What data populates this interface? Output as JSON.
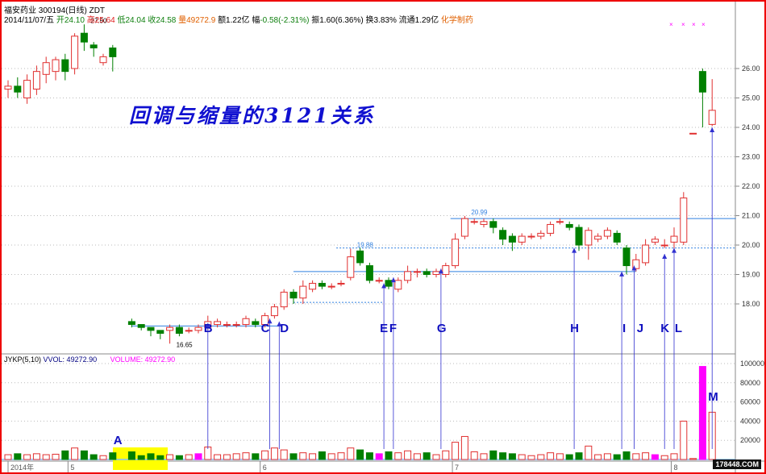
{
  "header": {
    "name": "福安药业 300194(日线) ZDT",
    "date": "2014/11/07/五",
    "open_l": "开",
    "open": "24.10",
    "high_l": "高",
    "high": "25.64",
    "low_l": "低",
    "low": "24.04",
    "close_l": "收",
    "close": "24.58",
    "vol_l": "量",
    "vol": "49272.9",
    "amt": "额1.22亿",
    "chg_l": "幅",
    "chg": "-0.58(-2.31%)",
    "amp": "振1.60(6.36%)",
    "turn": "换3.83%",
    "float": "流通1.29亿",
    "sector": "化学制药"
  },
  "annotation_title": "回调与缩量的3121关系",
  "volume_legend": {
    "ind": "JYKP(5,10)",
    "vvol": "VVOL: 49272.90",
    "volume": "VOLUME: 49272.90"
  },
  "watermark": "178448.COM",
  "colors": {
    "up": "#e03030",
    "down": "#008000",
    "line": "#3080e0",
    "arrow": "#3030d0",
    "highlight": "#ffff00",
    "magenta": "#ff00ff"
  },
  "chart_data": {
    "type": "candlestick",
    "price_ticks": [
      "26.00",
      "25.00",
      "24.00",
      "23.00",
      "22.00",
      "21.00",
      "20.00",
      "19.00",
      "18.00"
    ],
    "price_tick_values": [
      26,
      25,
      24,
      23,
      22,
      21,
      20,
      19,
      18
    ],
    "volume_ticks": [
      "100000",
      "80000",
      "60000",
      "40000",
      "20000"
    ],
    "volume_tick_values": [
      100000,
      80000,
      60000,
      40000,
      20000
    ],
    "x_labels": [
      {
        "i": 0,
        "t": "2014年"
      },
      {
        "i": 6.3,
        "t": "5"
      },
      {
        "i": 26.5,
        "t": "6"
      },
      {
        "i": 46.7,
        "t": "7"
      },
      {
        "i": 69.7,
        "t": "8"
      }
    ],
    "price_labels": [
      {
        "i": 8,
        "p": 27.5,
        "t": "27.50"
      },
      {
        "i": 17,
        "p": 16.65,
        "t": "16.65"
      },
      {
        "i": 36,
        "p": 19.88,
        "t": "19.88"
      },
      {
        "i": 48,
        "p": 20.99,
        "t": "20.99"
      }
    ],
    "candles": [
      [
        25.3,
        25.4,
        25.6,
        25.0,
        5000
      ],
      [
        25.4,
        25.2,
        25.7,
        25.0,
        6000
      ],
      [
        25.0,
        25.6,
        25.8,
        24.8,
        5000
      ],
      [
        25.3,
        25.9,
        26.1,
        25.1,
        6000
      ],
      [
        25.8,
        26.2,
        26.4,
        25.5,
        5000
      ],
      [
        25.9,
        26.3,
        26.4,
        25.6,
        5500
      ],
      [
        26.3,
        25.9,
        26.5,
        25.6,
        9000
      ],
      [
        26.0,
        27.1,
        27.2,
        25.8,
        12000
      ],
      [
        27.2,
        26.9,
        27.5,
        26.6,
        9000
      ],
      [
        26.8,
        26.7,
        26.9,
        26.4,
        5000
      ],
      [
        26.2,
        26.4,
        26.5,
        26.1,
        4000
      ],
      [
        26.7,
        26.4,
        26.8,
        25.9,
        7000
      ],
      null,
      [
        17.4,
        17.3,
        17.5,
        17.2,
        8000
      ],
      [
        17.3,
        17.2,
        17.3,
        17.1,
        4000
      ],
      [
        17.2,
        17.1,
        17.2,
        16.9,
        6000
      ],
      [
        17.1,
        17.0,
        17.1,
        16.8,
        4000
      ],
      [
        17.1,
        17.2,
        17.3,
        16.65,
        5000
      ],
      [
        17.2,
        17.0,
        17.3,
        16.9,
        4000
      ],
      [
        17.1,
        17.1,
        17.2,
        17.0,
        5000
      ],
      [
        17.1,
        17.2,
        17.3,
        17.0,
        6000
      ],
      [
        17.2,
        17.4,
        17.6,
        17.1,
        13000
      ],
      [
        17.3,
        17.4,
        17.5,
        17.2,
        5000
      ],
      [
        17.3,
        17.3,
        17.4,
        17.2,
        5000
      ],
      [
        17.3,
        17.3,
        17.4,
        17.2,
        6000
      ],
      [
        17.3,
        17.5,
        17.6,
        17.2,
        7000
      ],
      [
        17.4,
        17.3,
        17.5,
        17.2,
        6000
      ],
      [
        17.3,
        17.6,
        17.7,
        17.2,
        9000
      ],
      [
        17.6,
        17.9,
        18.0,
        17.5,
        12000
      ],
      [
        17.9,
        18.4,
        18.5,
        17.8,
        10000
      ],
      [
        18.4,
        18.2,
        18.5,
        18.0,
        6000
      ],
      [
        18.2,
        18.6,
        18.8,
        18.0,
        7000
      ],
      [
        18.5,
        18.7,
        18.8,
        18.4,
        6000
      ],
      [
        18.7,
        18.6,
        18.8,
        18.5,
        8000
      ],
      [
        18.6,
        18.6,
        18.7,
        18.5,
        6000
      ],
      [
        18.7,
        18.7,
        18.8,
        18.6,
        7000
      ],
      [
        18.9,
        19.6,
        19.88,
        18.8,
        12000
      ],
      [
        19.8,
        19.4,
        19.9,
        19.3,
        10000
      ],
      [
        19.3,
        18.8,
        19.4,
        18.7,
        7000
      ],
      [
        18.8,
        18.8,
        18.9,
        18.7,
        6000
      ],
      [
        18.8,
        18.6,
        18.9,
        18.5,
        8000
      ],
      [
        18.5,
        18.8,
        18.9,
        18.4,
        7000
      ],
      [
        18.8,
        19.1,
        19.3,
        18.7,
        9000
      ],
      [
        19.1,
        19.1,
        19.2,
        18.9,
        6000
      ],
      [
        19.1,
        19.0,
        19.2,
        18.9,
        7000
      ],
      [
        19.0,
        19.1,
        19.2,
        18.9,
        5000
      ],
      [
        19.0,
        19.3,
        19.4,
        18.9,
        9000
      ],
      [
        19.3,
        20.2,
        20.4,
        19.2,
        18000
      ],
      [
        20.3,
        20.9,
        20.99,
        20.2,
        24000
      ],
      [
        20.8,
        20.8,
        20.9,
        20.7,
        8000
      ],
      [
        20.7,
        20.8,
        20.9,
        20.6,
        6000
      ],
      [
        20.8,
        20.6,
        20.9,
        20.4,
        9000
      ],
      [
        20.5,
        20.2,
        20.6,
        20.0,
        7000
      ],
      [
        20.3,
        20.1,
        20.4,
        19.8,
        6000
      ],
      [
        20.1,
        20.3,
        20.4,
        20.0,
        5000
      ],
      [
        20.3,
        20.3,
        20.4,
        20.2,
        4000
      ],
      [
        20.3,
        20.4,
        20.5,
        20.2,
        5000
      ],
      [
        20.4,
        20.7,
        20.8,
        20.3,
        7000
      ],
      [
        20.8,
        20.8,
        20.9,
        20.7,
        6000
      ],
      [
        20.7,
        20.6,
        20.8,
        20.5,
        5000
      ],
      [
        20.6,
        20.0,
        20.7,
        19.8,
        7000
      ],
      [
        20.0,
        20.5,
        20.6,
        19.5,
        14000
      ],
      [
        20.2,
        20.3,
        20.4,
        20.1,
        5000
      ],
      [
        20.3,
        20.5,
        20.6,
        20.2,
        6000
      ],
      [
        20.4,
        20.1,
        20.5,
        20.0,
        5000
      ],
      [
        19.9,
        19.3,
        20.0,
        19.0,
        8000
      ],
      [
        19.2,
        19.5,
        19.7,
        19.1,
        6000
      ],
      [
        19.4,
        20.0,
        20.2,
        19.3,
        7000
      ],
      [
        20.1,
        20.2,
        20.3,
        20.0,
        5000
      ],
      [
        20.0,
        20.0,
        20.2,
        19.9,
        4000
      ],
      [
        20.1,
        20.3,
        20.6,
        19.8,
        6000
      ],
      [
        20.1,
        21.6,
        21.8,
        20.0,
        40000
      ],
      [
        23.8,
        23.8,
        23.8,
        23.8,
        1000
      ],
      [
        25.9,
        25.2,
        26.0,
        24.0,
        97000
      ],
      [
        24.1,
        24.58,
        25.64,
        24.04,
        49272
      ]
    ],
    "magenta_vol": [
      20,
      39,
      68,
      73
    ],
    "letters": [
      {
        "t": "A",
        "i": 11.5
      },
      {
        "t": "B",
        "i": 21
      },
      {
        "t": "C",
        "i": 27
      },
      {
        "t": "D",
        "i": 29
      },
      {
        "t": "E",
        "i": 39.5
      },
      {
        "t": "F",
        "i": 40.5
      },
      {
        "t": "G",
        "i": 45.5
      },
      {
        "t": "H",
        "i": 59.5
      },
      {
        "t": "I",
        "i": 65
      },
      {
        "t": "J",
        "i": 66.5
      },
      {
        "t": "K",
        "i": 69
      },
      {
        "t": "L",
        "i": 70.5
      },
      {
        "t": "M",
        "i": 74
      }
    ],
    "arrows": [
      {
        "i": 21,
        "p": 17.35
      },
      {
        "i": 27.5,
        "p": 17.5
      },
      {
        "i": 28.5,
        "p": 17.4
      },
      {
        "i": 39.5,
        "p": 18.7
      },
      {
        "i": 40.5,
        "p": 18.9
      },
      {
        "i": 45.5,
        "p": 19.2
      },
      {
        "i": 59.5,
        "p": 19.9
      },
      {
        "i": 64.5,
        "p": 19.1
      },
      {
        "i": 65.8,
        "p": 19.3
      },
      {
        "i": 69,
        "p": 19.7
      },
      {
        "i": 70,
        "p": 19.9
      },
      {
        "i": 74,
        "p": 24.0
      }
    ],
    "hlines": [
      {
        "p": 17.25,
        "a": 13,
        "b": 28.5,
        "d": false
      },
      {
        "p": 18.05,
        "a": 30,
        "b": 39.5,
        "d": true
      },
      {
        "p": 19.1,
        "a": 30,
        "b": 66,
        "d": false
      },
      {
        "p": 19.9,
        "a": 34.5,
        "b": 76.5,
        "d": true
      },
      {
        "p": 20.9,
        "a": 46.5,
        "b": 76.5,
        "d": false
      }
    ]
  }
}
